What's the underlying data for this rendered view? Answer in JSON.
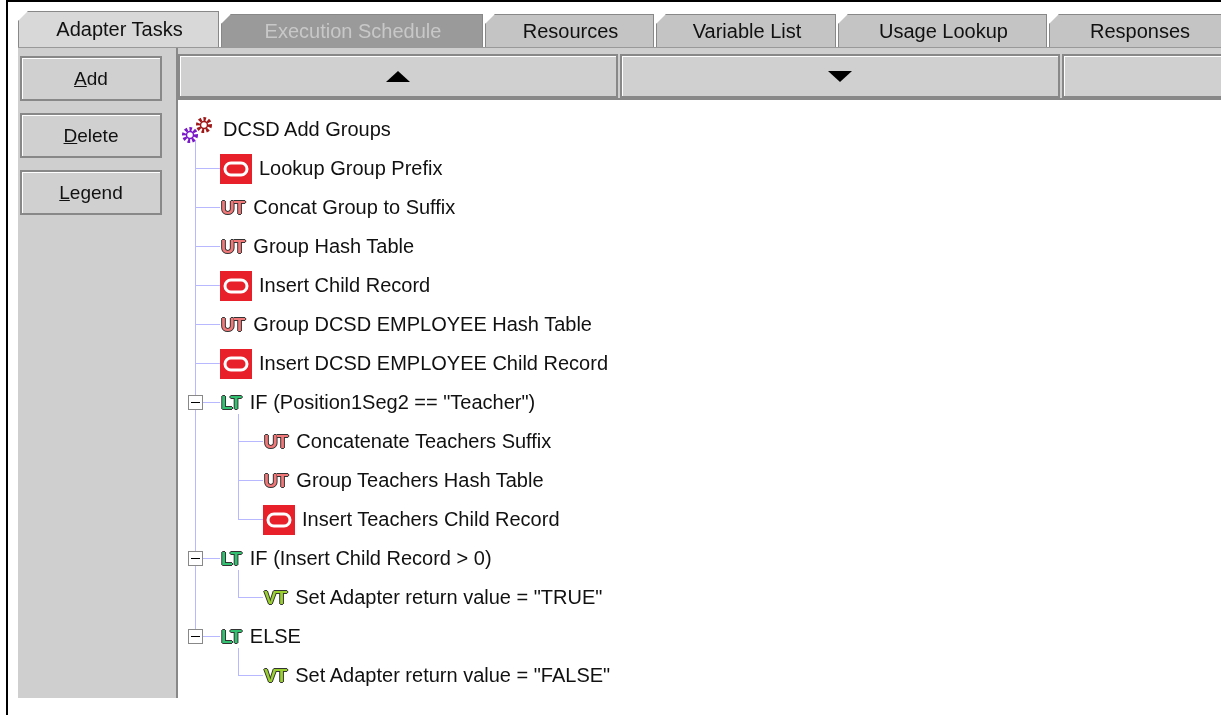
{
  "tabs": [
    {
      "label": "Adapter Tasks",
      "selected": true,
      "disabled": false
    },
    {
      "label": "Execution Schedule",
      "selected": false,
      "disabled": true
    },
    {
      "label": "Resources",
      "selected": false,
      "disabled": false
    },
    {
      "label": "Variable List",
      "selected": false,
      "disabled": false
    },
    {
      "label": "Usage Lookup",
      "selected": false,
      "disabled": false
    },
    {
      "label": "Responses",
      "selected": false,
      "disabled": false
    }
  ],
  "side_buttons": [
    "Add",
    "Delete",
    "Legend"
  ],
  "tree": {
    "label": "DCSD Add Groups",
    "kind": "gears",
    "children": [
      {
        "label": "Lookup Group Prefix",
        "kind": "db"
      },
      {
        "label": "Concat Group to Suffix",
        "kind": "ut",
        "badge": "UT"
      },
      {
        "label": "Group Hash Table",
        "kind": "ut",
        "badge": "UT"
      },
      {
        "label": "Insert Child Record",
        "kind": "db"
      },
      {
        "label": "Group DCSD EMPLOYEE Hash Table",
        "kind": "ut",
        "badge": "UT"
      },
      {
        "label": "Insert DCSD EMPLOYEE Child Record",
        "kind": "db"
      },
      {
        "label": "IF (Position1Seg2 == \"Teacher\")",
        "kind": "lt",
        "badge": "LT",
        "expanded": true,
        "children": [
          {
            "label": "Concatenate Teachers Suffix",
            "kind": "ut",
            "badge": "UT"
          },
          {
            "label": "Group Teachers Hash Table",
            "kind": "ut",
            "badge": "UT"
          },
          {
            "label": "Insert Teachers Child Record",
            "kind": "db"
          }
        ]
      },
      {
        "label": "IF (Insert Child Record > 0)",
        "kind": "lt",
        "badge": "LT",
        "expanded": true,
        "children": [
          {
            "label": "Set Adapter return value = \"TRUE\"",
            "kind": "vt",
            "badge": "VT"
          }
        ]
      },
      {
        "label": "ELSE",
        "kind": "lt",
        "badge": "LT",
        "expanded": true,
        "children": [
          {
            "label": "Set Adapter return value = \"FALSE\"",
            "kind": "vt",
            "badge": "VT"
          }
        ]
      }
    ]
  }
}
